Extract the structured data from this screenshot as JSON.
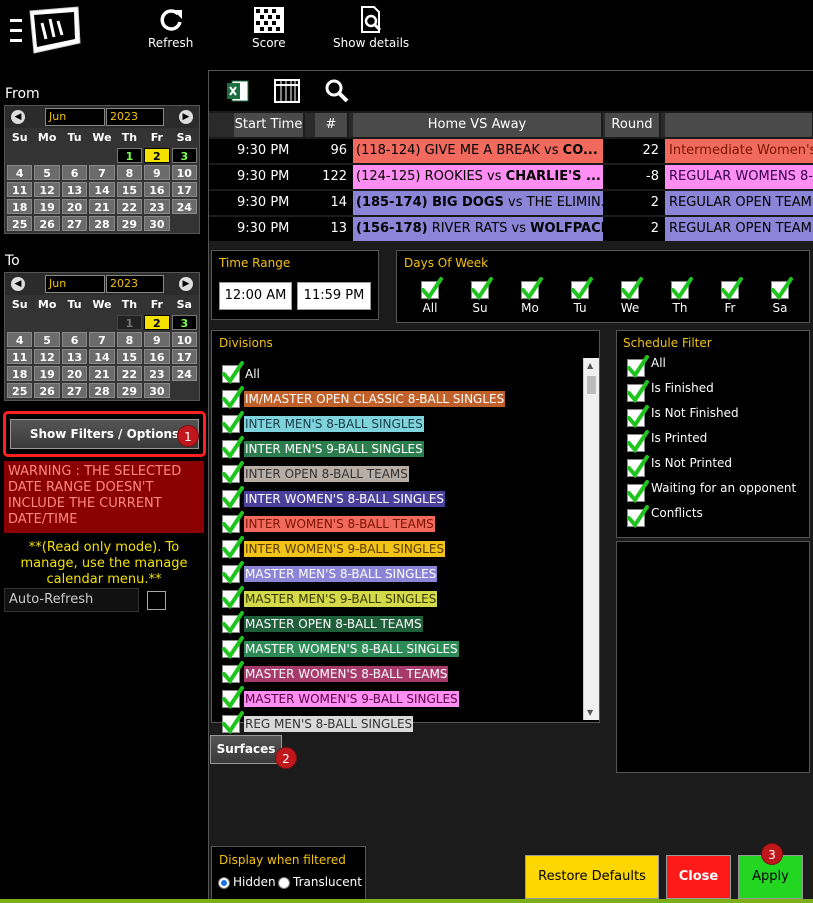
{
  "toolbar": {
    "refresh_label": "Refresh",
    "score_label": "Score",
    "show_details_label": "Show details"
  },
  "from_calendar": {
    "label": "From",
    "month": "Jun",
    "year": "2023",
    "weekdays": [
      "Su",
      "Mo",
      "Tu",
      "We",
      "Th",
      "Fr",
      "Sa"
    ],
    "weeks": [
      [
        "",
        "",
        "",
        "",
        "1",
        "2",
        "3"
      ],
      [
        "4",
        "5",
        "6",
        "7",
        "8",
        "9",
        "10"
      ],
      [
        "11",
        "12",
        "13",
        "14",
        "15",
        "16",
        "17"
      ],
      [
        "18",
        "19",
        "20",
        "21",
        "22",
        "23",
        "24"
      ],
      [
        "25",
        "26",
        "27",
        "28",
        "29",
        "30",
        ""
      ]
    ],
    "selected_day": "2",
    "current_days": [
      "1",
      "3"
    ]
  },
  "to_calendar": {
    "label": "To",
    "month": "Jun",
    "year": "2023",
    "weekdays": [
      "Su",
      "Mo",
      "Tu",
      "We",
      "Th",
      "Fr",
      "Sa"
    ],
    "weeks": [
      [
        "",
        "",
        "",
        "",
        "1",
        "2",
        "3"
      ],
      [
        "4",
        "5",
        "6",
        "7",
        "8",
        "9",
        "10"
      ],
      [
        "11",
        "12",
        "13",
        "14",
        "15",
        "16",
        "17"
      ],
      [
        "18",
        "19",
        "20",
        "21",
        "22",
        "23",
        "24"
      ],
      [
        "25",
        "26",
        "27",
        "28",
        "29",
        "30",
        ""
      ]
    ],
    "selected_day": "2",
    "current_days": [
      "3"
    ],
    "disabled_days": [
      "1"
    ]
  },
  "sidebar": {
    "show_filters_label": "Show Filters / Options",
    "badge_1": "1",
    "warning": "WARNING : THE SELECTED DATE RANGE DOESN'T INCLUDE THE CURRENT DATE/TIME",
    "readonly_note": "**(Read only mode). To manage, use the manage calendar menu.**",
    "auto_refresh_label": "Auto-Refresh"
  },
  "table": {
    "columns": [
      "Start Time",
      "#",
      "Home VS Away",
      "Round"
    ],
    "rows": [
      {
        "time": "9:30 PM",
        "num": "96",
        "home_prefix": "(118-124) GIVE ME A BREAK vs ",
        "away_bold": "CO...",
        "round": "22",
        "division": "Intermediate Women's",
        "bg": "#f26a5e",
        "dbg": "#f26a5e",
        "dcolor": "#7a1500"
      },
      {
        "time": "9:30 PM",
        "num": "122",
        "home_prefix": "(124-125) ROOKIES vs ",
        "away_bold": "CHARLIE'S ...",
        "round": "-8",
        "division": "REGULAR WOMENS 8-",
        "bg": "#ff8ef2",
        "dbg": "#ff8ef2",
        "dcolor": "#33004a"
      },
      {
        "time": "9:30 PM",
        "num": "14",
        "home_prefix_bold": "(185-174) BIG DOGS",
        "home_suffix": " vs THE ELIMIN...",
        "round": "2",
        "division": "REGULAR OPEN TEAM",
        "bg": "#8c84d6",
        "dbg": "#8c84d6",
        "dcolor": "#000"
      },
      {
        "time": "9:30 PM",
        "num": "13",
        "home_prefix_bold": "(156-178)",
        "home_mid": " RIVER RATS vs ",
        "away_bold": "WOLFPACK",
        "round": "2",
        "division": "REGULAR OPEN TEAM",
        "bg": "#8c84d6",
        "dbg": "#8c84d6",
        "dcolor": "#000"
      }
    ]
  },
  "time_range": {
    "title": "Time Range",
    "start": "12:00 AM",
    "end": "11:59 PM"
  },
  "days_of_week": {
    "title": "Days Of Week",
    "days": [
      "All",
      "Su",
      "Mo",
      "Tu",
      "We",
      "Th",
      "Fr",
      "Sa"
    ]
  },
  "divisions": {
    "title": "Divisions",
    "items": [
      {
        "label": "All",
        "bg": "transparent",
        "color": "#ffffff"
      },
      {
        "label": "IM/MASTER OPEN CLASSIC 8-BALL SINGLES",
        "bg": "#c0602a",
        "color": "#ffffff"
      },
      {
        "label": "INTER MEN'S 8-BALL SINGLES",
        "bg": "#7fd3dc",
        "color": "#1a3d4a"
      },
      {
        "label": "INTER MEN'S 9-BALL SINGLES",
        "bg": "#2e7d4f",
        "color": "#ffffff"
      },
      {
        "label": "INTER OPEN 8-BALL TEAMS",
        "bg": "#b9aea6",
        "color": "#333333"
      },
      {
        "label": "INTER WOMEN'S 8-BALL SINGLES",
        "bg": "#4b3f9c",
        "color": "#ffffff"
      },
      {
        "label": "INTER WOMEN'S 8-BALL TEAMS",
        "bg": "#f26a5e",
        "color": "#7a1500"
      },
      {
        "label": "INTER WOMEN'S 9-BALL SINGLES",
        "bg": "#f2c318",
        "color": "#5a3c00"
      },
      {
        "label": "MASTER MEN'S 8-BALL SINGLES",
        "bg": "#8c84d6",
        "color": "#ffffff"
      },
      {
        "label": "MASTER MEN'S 9-BALL SINGLES",
        "bg": "#d4da4a",
        "color": "#3a3a00"
      },
      {
        "label": "MASTER OPEN 8-BALL TEAMS",
        "bg": "#1f5f3a",
        "color": "#ffffff"
      },
      {
        "label": "MASTER WOMEN'S 8-BALL SINGLES",
        "bg": "#2e8b57",
        "color": "#ffffff"
      },
      {
        "label": "MASTER WOMEN'S 8-BALL TEAMS",
        "bg": "#a63a6a",
        "color": "#ffffff"
      },
      {
        "label": "MASTER WOMEN'S 9-BALL SINGLES",
        "bg": "#ff8ef2",
        "color": "#5a0048"
      },
      {
        "label": "REG MEN'S 8-BALL SINGLES",
        "bg": "#d9d9d9",
        "color": "#333333"
      }
    ]
  },
  "schedule_filter": {
    "title": "Schedule Filter",
    "items": [
      "All",
      "Is Finished",
      "Is Not Finished",
      "Is Printed",
      "Is Not Printed",
      "Waiting for an opponent",
      "Conflicts"
    ]
  },
  "surfaces": {
    "label": "Surfaces",
    "badge": "2"
  },
  "display_filtered": {
    "title": "Display when filtered",
    "hidden_label": "Hidden",
    "translucent_label": "Translucent"
  },
  "actions": {
    "restore_label": "Restore Defaults",
    "close_label": "Close",
    "apply_label": "Apply",
    "badge_3": "3"
  },
  "colors": {
    "accent_yellow": "#f4c20d",
    "warning_bg": "#8b0000",
    "close_red": "#ff1a1a",
    "apply_green": "#22d622",
    "restore_yellow": "#ffd700",
    "check_green": "#1ec31e"
  }
}
